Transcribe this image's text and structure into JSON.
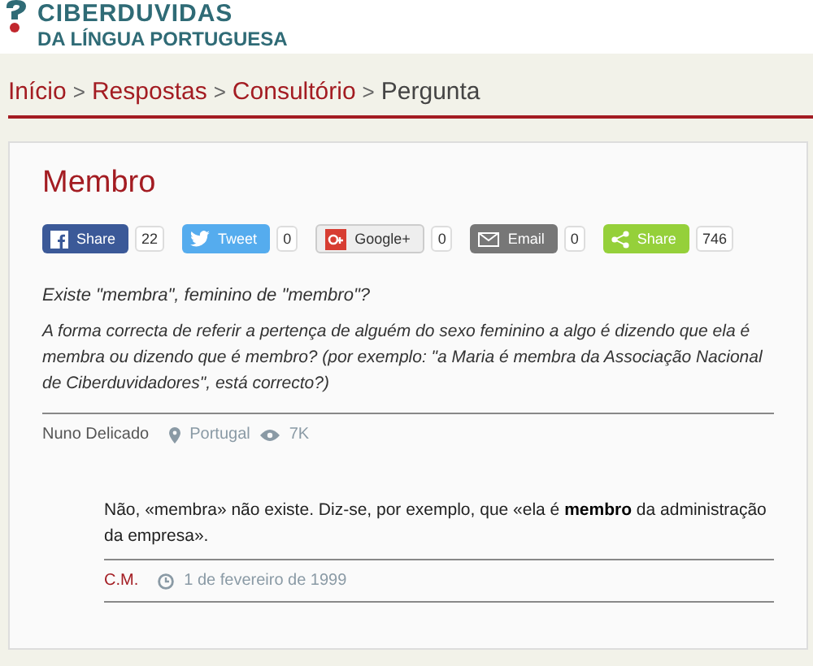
{
  "logo": {
    "name": "CIBERDUVIDAS",
    "tagline": "DA LÍNGUA PORTUGUESA"
  },
  "breadcrumb": [
    {
      "label": "Início",
      "current": false
    },
    {
      "label": "Respostas",
      "current": false
    },
    {
      "label": "Consultório",
      "current": false
    },
    {
      "label": "Pergunta",
      "current": true
    }
  ],
  "breadcrumb_separator": ">",
  "title": "Membro",
  "share_buttons": [
    {
      "kind": "facebook",
      "label": "Share",
      "count": "22"
    },
    {
      "kind": "twitter",
      "label": "Tweet",
      "count": "0"
    },
    {
      "kind": "google",
      "label": "Google+",
      "count": "0"
    },
    {
      "kind": "email",
      "label": "Email",
      "count": "0"
    },
    {
      "kind": "sharethis",
      "label": "Share",
      "count": "746"
    }
  ],
  "question": {
    "subject": "Existe \"membra\", feminino de \"membro\"?",
    "body": "A forma correcta de referir a pertença de alguém do sexo feminino a algo é dizendo que ela é membra ou dizendo que é membro? (por exemplo: \"a Maria é membra da Associação Nacional de Ciberduvidadores\", está correcto?)",
    "author": "Nuno Delicado",
    "country": "Portugal",
    "views": "7K"
  },
  "answer": {
    "text": "Não, «membra» não existe. Diz-se, por exemplo, que «ela é **membro** da administração da empresa».",
    "author": "C.M.",
    "date": "1 de fevereiro de 1999"
  }
}
